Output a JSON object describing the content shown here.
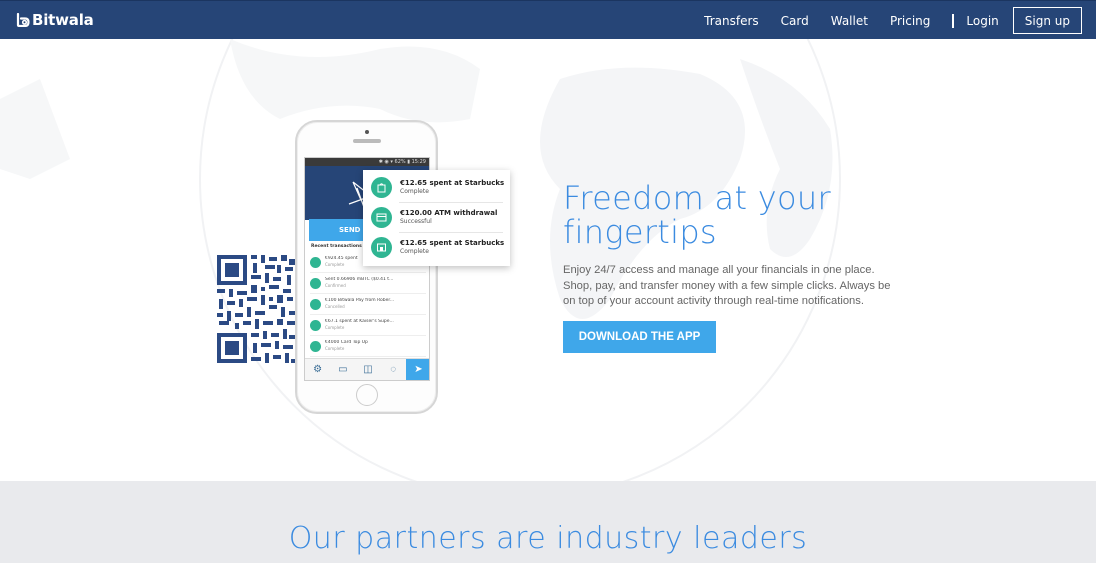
{
  "brand": {
    "name": "Bitwala",
    "color": "#264577",
    "accent": "#3fa7ea",
    "headline_color": "#3b8be0"
  },
  "nav": {
    "links": [
      "Transfers",
      "Card",
      "Wallet",
      "Pricing"
    ],
    "login": "Login",
    "signup": "Sign up"
  },
  "hero": {
    "headline": "Freedom at your fingertips",
    "description": "Enjoy 24/7 access and manage all your financials in one place. Shop, pay, and transfer money with a few simple clicks. Always be on top of your account activity through real-time notifications.",
    "download_button": "DOWNLOAD THE APP"
  },
  "phone": {
    "status_bar": "✱ ◉ ▾ 62% ▮ 15:29",
    "send_button": "SEND M",
    "recent_label": "Recent transactions",
    "transactions": [
      {
        "title": "€924.45 spent",
        "status": "Complete",
        "icon": "bag-icon"
      },
      {
        "title": "Sent 0.66906 mBTC ($0.41 t...",
        "status": "Confirmed",
        "icon": "bitcoin-icon"
      },
      {
        "title": "€100 Bitwala Pay from Rober...",
        "status": "Cancelled",
        "icon": "transfer-icon"
      },
      {
        "title": "€67.1 spent at Kaiser's Supe...",
        "status": "Complete",
        "icon": "cart-icon"
      },
      {
        "title": "€4000 Card Top Up",
        "status": "Complete",
        "icon": "card-icon"
      }
    ],
    "tabs": [
      "settings-icon",
      "card-icon",
      "wallet-icon",
      "chat-icon",
      "send-icon"
    ]
  },
  "notifications": [
    {
      "title": "€12.65 spent at Starbucks",
      "status": "Complete",
      "icon": "shopping-bag-icon"
    },
    {
      "title": "€120.00 ATM withdrawal",
      "status": "Successful",
      "icon": "atm-icon"
    },
    {
      "title": "€12.65 spent at Starbucks",
      "status": "Complete",
      "icon": "shop-icon"
    }
  ],
  "partners": {
    "title": "Our partners are industry leaders"
  }
}
